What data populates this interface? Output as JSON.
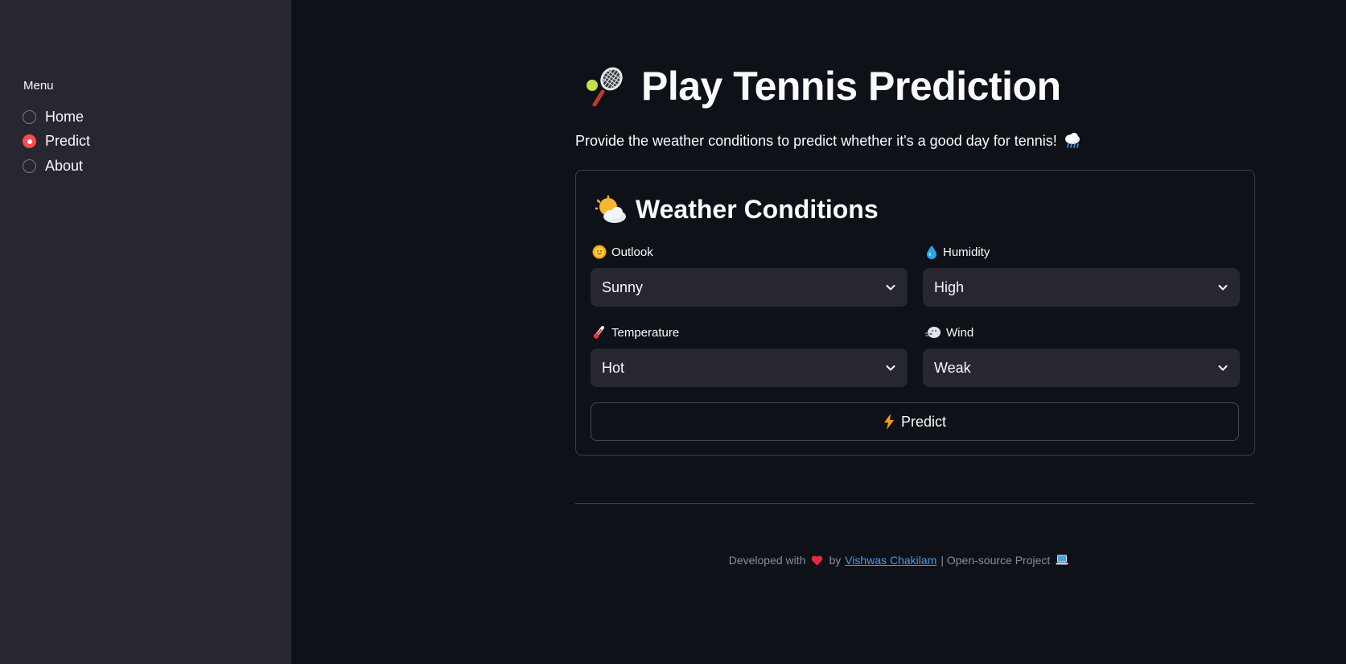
{
  "sidebar": {
    "menu_label": "Menu",
    "items": [
      {
        "label": "Home",
        "selected": false
      },
      {
        "label": "Predict",
        "selected": true
      },
      {
        "label": "About",
        "selected": false
      }
    ]
  },
  "main": {
    "title": "Play Tennis Prediction",
    "title_icon": "tennis-racket-icon",
    "subtitle": "Provide the weather conditions to predict whether it's a good day for tennis!",
    "subtitle_icon": "rain-cloud-icon"
  },
  "form": {
    "title": "Weather Conditions",
    "title_icon": "sun-behind-cloud-icon",
    "fields": {
      "outlook": {
        "label": "Outlook",
        "value": "Sunny",
        "icon": "sun-face-icon"
      },
      "humidity": {
        "label": "Humidity",
        "value": "High",
        "icon": "droplet-icon"
      },
      "temperature": {
        "label": "Temperature",
        "value": "Hot",
        "icon": "thermometer-icon"
      },
      "wind": {
        "label": "Wind",
        "value": "Weak",
        "icon": "wind-face-icon"
      }
    },
    "predict_label": "Predict",
    "predict_icon": "lightning-icon"
  },
  "footer": {
    "prefix": "Developed with",
    "by": "by",
    "author": "Vishwas Chakilam",
    "suffix": "| Open-source Project",
    "heart_icon": "heart-icon",
    "laptop_icon": "laptop-icon"
  },
  "colors": {
    "background": "#0e1117",
    "sidebar": "#262730",
    "accent": "#ff4b4b",
    "link": "#3d9df3",
    "text": "#fafafa"
  }
}
